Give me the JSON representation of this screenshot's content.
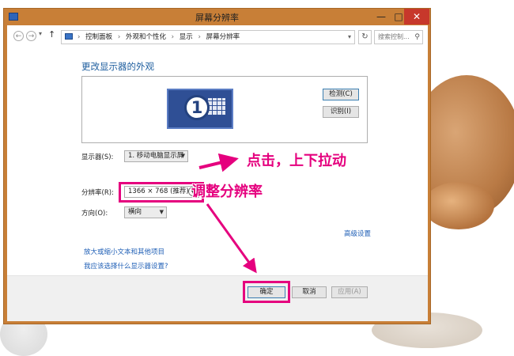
{
  "window": {
    "title": "屏幕分辨率",
    "buttons": {
      "minimize": "—",
      "maximize": "□",
      "close": "✕"
    }
  },
  "address_bar": {
    "back_icon": "←",
    "forward_icon": "→",
    "dropdown_icon": "▾",
    "up_icon": "↑",
    "breadcrumbs": [
      "控制面板",
      "外观和个性化",
      "显示",
      "屏幕分辨率"
    ],
    "separator": "›",
    "refresh_icon": "↻",
    "search_placeholder": "搜索控制...",
    "search_icon": "⚲"
  },
  "panel": {
    "heading": "更改显示器的外观",
    "monitor_number": "1",
    "detect_label": "检测(C)",
    "identify_label": "识别(I)",
    "display_label": "显示器(S):",
    "display_value": "1. 移动电脑显示屏",
    "resolution_label": "分辨率(R):",
    "resolution_value": "1366 × 768 (推荐)",
    "orientation_label": "方向(O):",
    "orientation_value": "横向",
    "advanced_link": "高级设置",
    "text_size_link": "放大或缩小文本和其他项目",
    "why_link": "我应该选择什么显示器设置?"
  },
  "footer": {
    "ok_label": "确定",
    "cancel_label": "取消",
    "apply_label": "应用(A)"
  },
  "annotations": {
    "click_hint": "点击，上下拉动",
    "adjust_hint": "调整分辨率",
    "highlight_color": "#e5007e"
  }
}
